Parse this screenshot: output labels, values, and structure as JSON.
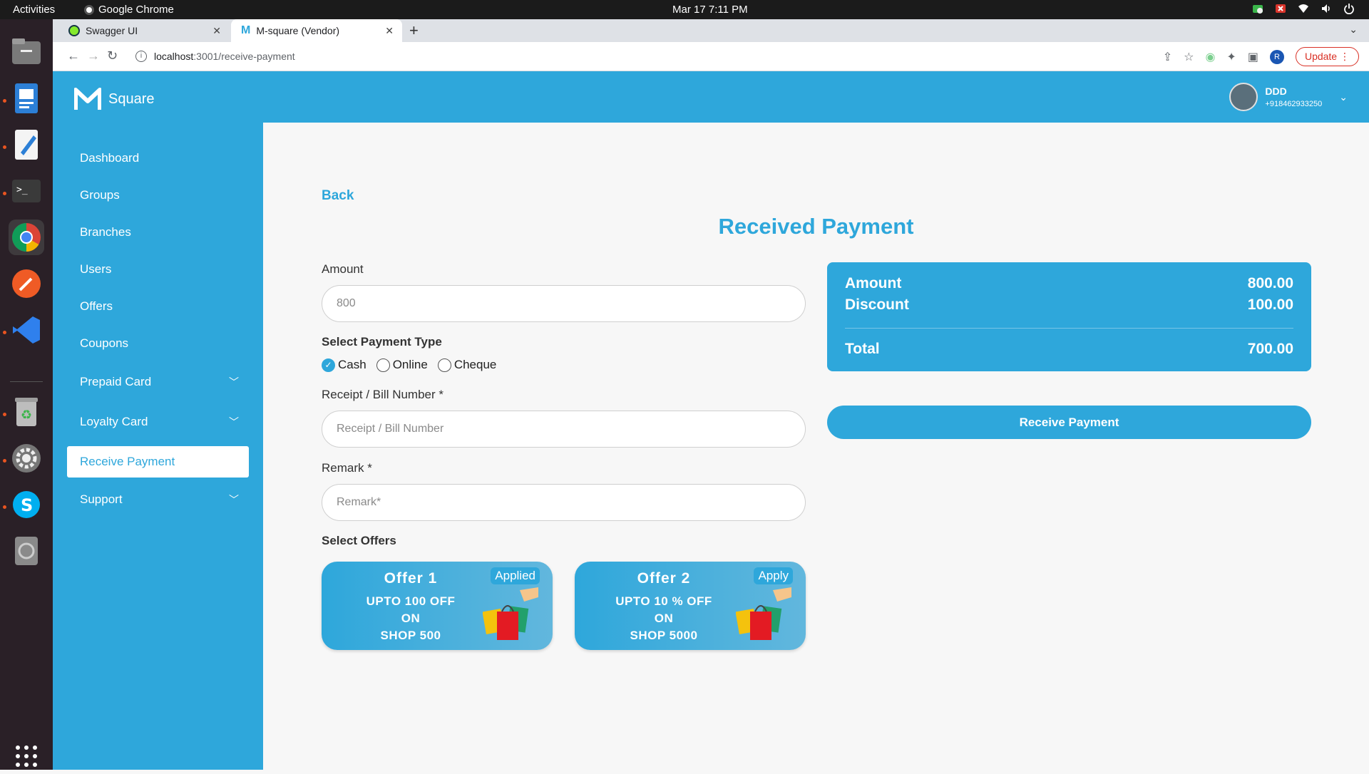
{
  "system": {
    "activities": "Activities",
    "app_name": "Google Chrome",
    "clock": "Mar 17  7:11 PM"
  },
  "browser": {
    "tabs": [
      {
        "title": "Swagger UI",
        "active": false
      },
      {
        "title": "M-square (Vendor)",
        "active": true
      }
    ],
    "url_host": "localhost",
    "url_path": ":3001/receive-payment",
    "profile_initial": "R",
    "update_label": "Update"
  },
  "app": {
    "brand": "Square",
    "user": {
      "name": "DDD",
      "phone": "+918462933250"
    },
    "nav": [
      {
        "label": "Dashboard",
        "expandable": false
      },
      {
        "label": "Groups",
        "expandable": false
      },
      {
        "label": "Branches",
        "expandable": false
      },
      {
        "label": "Users",
        "expandable": false
      },
      {
        "label": "Offers",
        "expandable": false
      },
      {
        "label": "Coupons",
        "expandable": false
      },
      {
        "label": "Prepaid Card",
        "expandable": true
      },
      {
        "label": "Loyalty Card",
        "expandable": true
      },
      {
        "label": "Receive Payment",
        "expandable": false,
        "selected": true
      },
      {
        "label": "Support",
        "expandable": true
      }
    ]
  },
  "page": {
    "back_label": "Back",
    "title": "Received Payment",
    "amount_label": "Amount",
    "amount_value": "800",
    "payment_type_label": "Select Payment Type",
    "payment_types": [
      "Cash",
      "Online",
      "Cheque"
    ],
    "payment_type_selected": "Cash",
    "receipt_label": "Receipt / Bill Number *",
    "receipt_placeholder": "Receipt / Bill Number",
    "remark_label": "Remark *",
    "remark_placeholder": "Remark*",
    "offers_label": "Select Offers",
    "offers": [
      {
        "title": "Offer 1",
        "line1": "UPTO 100 OFF",
        "line2": "ON",
        "line3": "SHOP 500",
        "status": "Applied"
      },
      {
        "title": "Offer 2",
        "line1": "UPTO 10 % OFF",
        "line2": "ON",
        "line3": "SHOP 5000",
        "status": "Apply"
      }
    ],
    "summary": {
      "amount_label": "Amount",
      "amount_value": "800.00",
      "discount_label": "Discount",
      "discount_value": "100.00",
      "total_label": "Total",
      "total_value": "700.00"
    },
    "receive_button": "Receive Payment"
  },
  "colors": {
    "primary": "#2ea7db",
    "dock": "#2a2027",
    "topbar": "#1b1b1b"
  }
}
